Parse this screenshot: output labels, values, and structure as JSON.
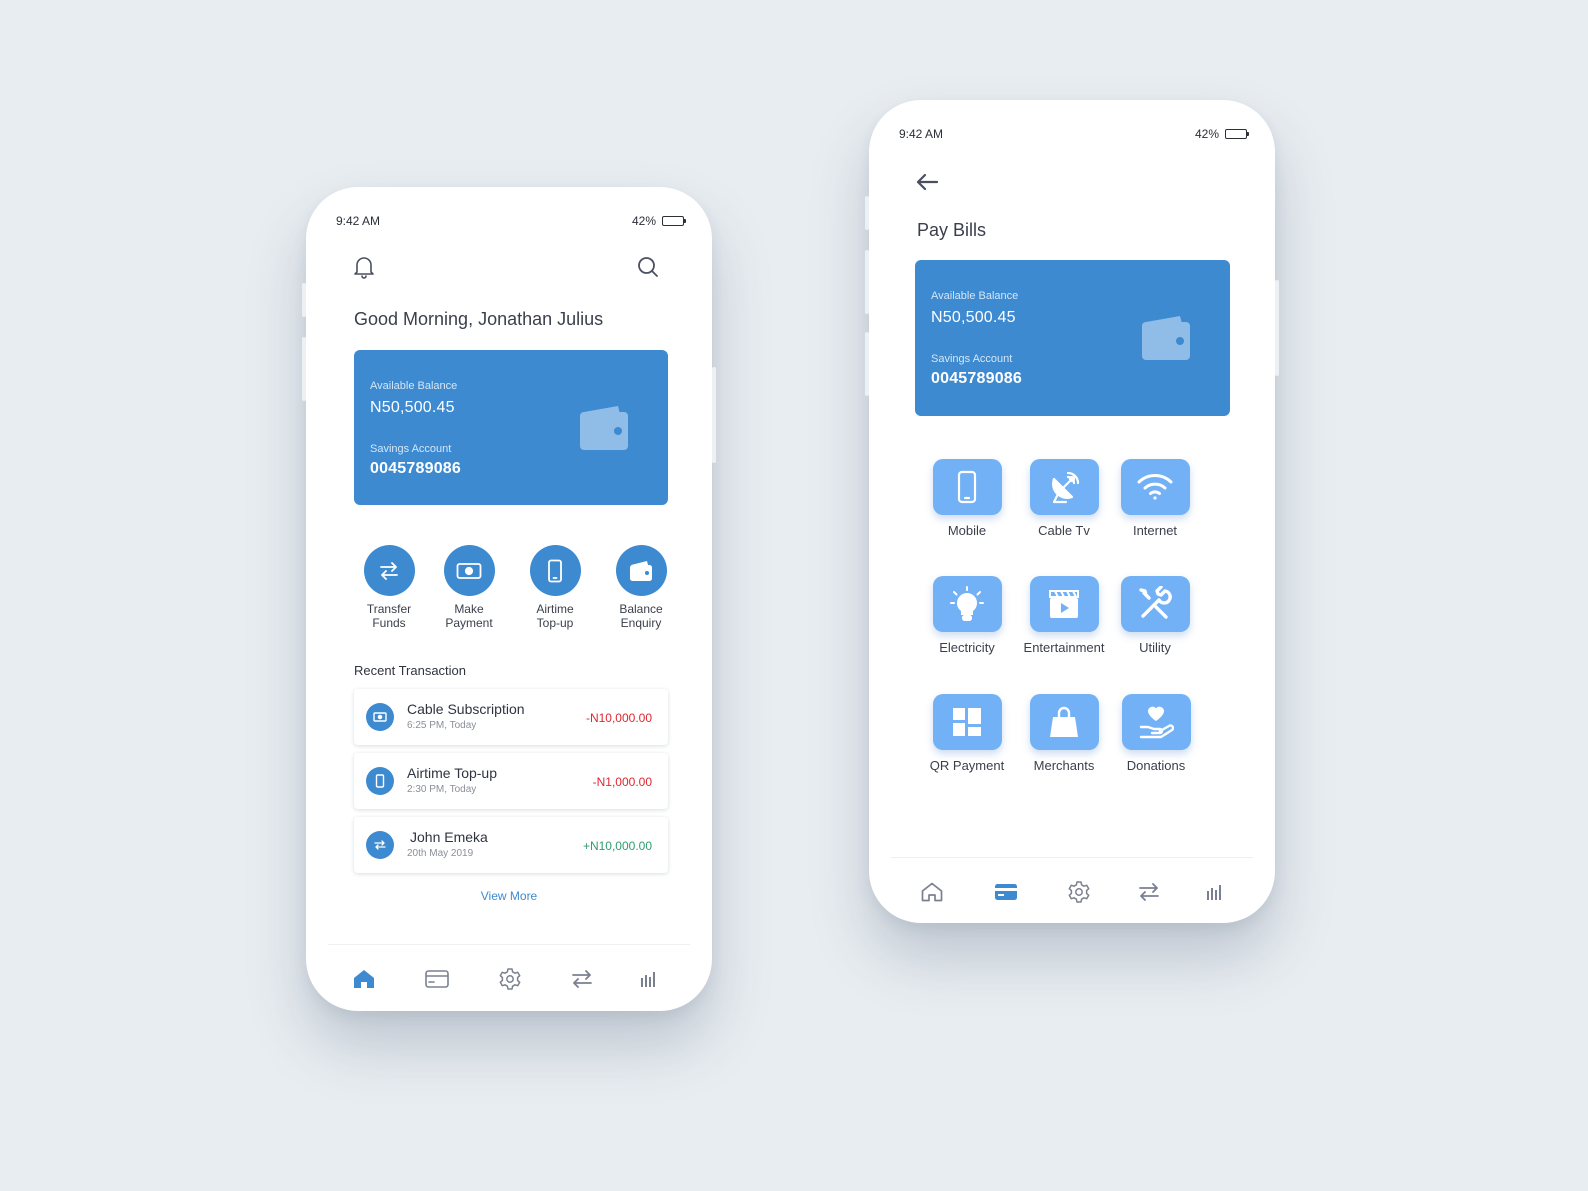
{
  "colors": {
    "background": "#e8edf1",
    "card": "#3d8ad0",
    "tile": "#72b1f5",
    "negative": "#e0262f",
    "positive": "#2e9e6b",
    "nav_inactive": "#7a8090"
  },
  "home": {
    "status": {
      "time": "9:42 AM",
      "battery": "42%",
      "battery_level": 0.42
    },
    "icons": {
      "notification": "bell-icon",
      "search": "search-icon"
    },
    "greeting": "Good Morning, Jonathan Julius",
    "card": {
      "balance_label": "Available Balance",
      "balance_value": "N50,500.45",
      "account_label": "Savings Account",
      "account_number": "0045789086",
      "icon": "wallet-icon"
    },
    "quick_actions": [
      {
        "line1": "Transfer",
        "line2": "Funds",
        "icon": "transfer-arrows-icon"
      },
      {
        "line1": "Make",
        "line2": "Payment",
        "icon": "cash-icon"
      },
      {
        "line1": "Airtime",
        "line2": "Top-up",
        "icon": "phone-icon"
      },
      {
        "line1": "Balance",
        "line2": "Enquiry",
        "icon": "wallet-icon"
      }
    ],
    "recent_title": "Recent Transaction",
    "transactions": [
      {
        "title": "Cable Subscription",
        "time": "6:25 PM, Today",
        "amount": "-N10,000.00",
        "type": "debit",
        "icon": "cash-icon"
      },
      {
        "title": "Airtime Top-up",
        "time": "2:30 PM, Today",
        "amount": "-N1,000.00",
        "type": "debit",
        "icon": "phone-icon"
      },
      {
        "title": "John Emeka",
        "time": "20th May 2019",
        "amount": "+N10,000.00",
        "type": "credit",
        "icon": "transfer-arrows-icon"
      }
    ],
    "view_more": "View More",
    "nav": [
      {
        "icon": "home-icon",
        "active": true
      },
      {
        "icon": "card-icon",
        "active": false
      },
      {
        "icon": "settings-gear-icon",
        "active": false
      },
      {
        "icon": "transfer-arrows-icon",
        "active": false
      },
      {
        "icon": "stats-bars-icon",
        "active": false
      }
    ]
  },
  "bills": {
    "status": {
      "time": "9:42 AM",
      "battery": "42%",
      "battery_level": 0.42
    },
    "back_icon": "arrow-left-icon",
    "title": "Pay Bills",
    "card": {
      "balance_label": "Available Balance",
      "balance_value": "N50,500.45",
      "account_label": "Savings Account",
      "account_number": "0045789086",
      "icon": "wallet-icon"
    },
    "categories": [
      {
        "label": "Mobile",
        "icon": "mobile-phone-icon"
      },
      {
        "label": "Cable Tv",
        "icon": "satellite-dish-icon"
      },
      {
        "label": "Internet",
        "icon": "wifi-icon"
      },
      {
        "label": "Electricity",
        "icon": "light-bulb-icon"
      },
      {
        "label": "Entertainment",
        "icon": "clapperboard-icon"
      },
      {
        "label": "Utility",
        "icon": "tools-icon"
      },
      {
        "label": "QR Payment",
        "icon": "grid-tiles-icon"
      },
      {
        "label": "Merchants",
        "icon": "shopping-bag-icon"
      },
      {
        "label": "Donations",
        "icon": "heart-hand-icon"
      }
    ],
    "nav": [
      {
        "icon": "home-icon",
        "active": false
      },
      {
        "icon": "card-icon",
        "active": true
      },
      {
        "icon": "settings-gear-icon",
        "active": false
      },
      {
        "icon": "transfer-arrows-icon",
        "active": false
      },
      {
        "icon": "stats-bars-icon",
        "active": false
      }
    ]
  }
}
